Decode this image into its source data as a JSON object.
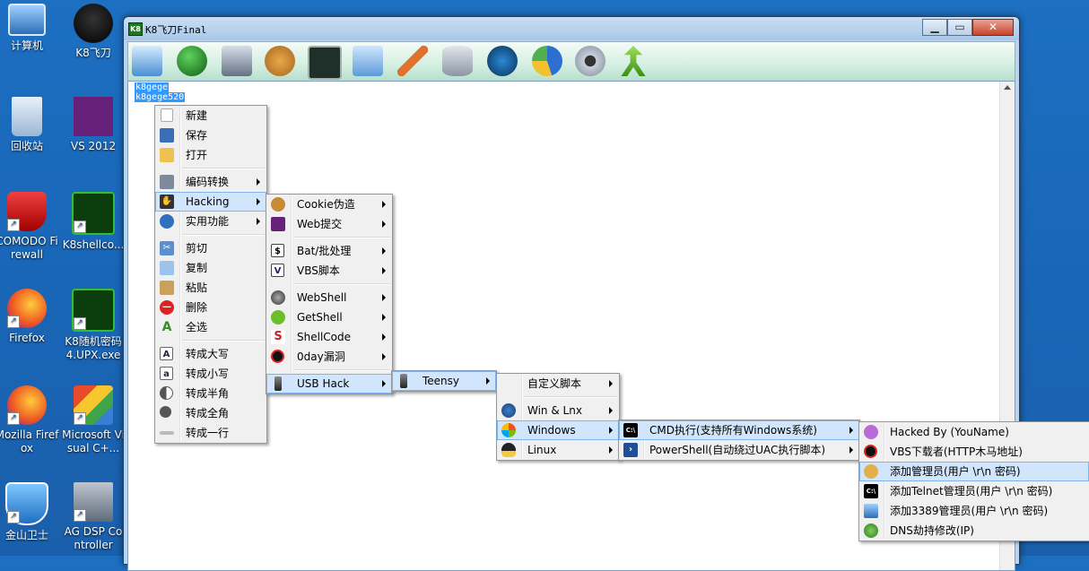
{
  "desktop": {
    "icons": [
      {
        "label": "计算机",
        "icon": "computer-icon"
      },
      {
        "label": "K8飞刀",
        "icon": "k8-ninja-icon"
      },
      {
        "label": "回收站",
        "icon": "recycle-bin-icon"
      },
      {
        "label": "VS 2012",
        "icon": "visual-studio-icon"
      },
      {
        "label": "COMODO Firewall",
        "icon": "comodo-icon"
      },
      {
        "label": "K8shellco...",
        "icon": "k8-icon"
      },
      {
        "label": "Firefox",
        "icon": "firefox-icon"
      },
      {
        "label": "K8随机密码4.UPX.exe",
        "icon": "k8-icon"
      },
      {
        "label": "Mozilla Firefox",
        "icon": "firefox-icon"
      },
      {
        "label": "Microsoft Visual C+...",
        "icon": "msvc-icon"
      },
      {
        "label": "金山卫士",
        "icon": "shield-icon"
      },
      {
        "label": "AG DSP Controller",
        "icon": "ag-dsp-icon"
      }
    ]
  },
  "window": {
    "badge": "K8",
    "title": "K8飞刀Final",
    "editor_lines": [
      "k8gege",
      "k8gege520"
    ]
  },
  "menu_main": {
    "items": [
      "新建",
      "保存",
      "打开",
      "编码转换",
      "Hacking",
      "实用功能",
      "剪切",
      "复制",
      "粘贴",
      "删除",
      "全选",
      "转成大写",
      "转成小写",
      "转成半角",
      "转成全角",
      "转成一行"
    ]
  },
  "menu_hacking": {
    "items": [
      "Cookie伪造",
      "Web提交",
      "Bat/批处理",
      "VBS脚本",
      "WebShell",
      "GetShell",
      "ShellCode",
      "0day漏洞",
      "USB Hack"
    ]
  },
  "menu_usb": {
    "items": [
      "Teensy"
    ]
  },
  "menu_teensy": {
    "items": [
      "自定义脚本",
      "Win & Lnx",
      "Windows",
      "Linux"
    ]
  },
  "menu_windows": {
    "items": [
      "CMD执行(支持所有Windows系统)",
      "PowerShell(自动绕过UAC执行脚本)"
    ]
  },
  "menu_cmd": {
    "items": [
      "Hacked By (YouName)",
      "VBS下载者(HTTP木马地址)",
      "添加管理员(用户 \\r\\n 密码)",
      "添加Telnet管理员(用户 \\r\\n 密码)",
      "添加3389管理员(用户 \\r\\n 密码)",
      "DNS劫持修改(IP)"
    ]
  },
  "colors": {
    "desktop": "#1a66b8",
    "highlight": "#d1e6fc",
    "selection": "#3399ff"
  }
}
